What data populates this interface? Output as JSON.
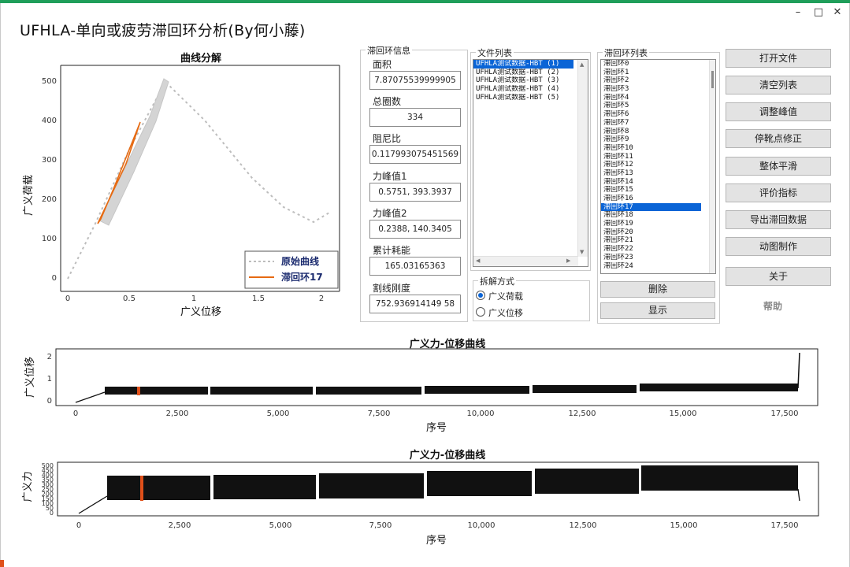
{
  "window": {
    "title": "UFHLA-单向或疲劳滞回环分析(By何小藤)",
    "minimize": "–",
    "maximize": "□",
    "close": "✕"
  },
  "decomp_chart": {
    "title": "曲线分解",
    "xlabel": "广义位移",
    "ylabel": "广义荷载",
    "xticks": [
      "0",
      "0.5",
      "1",
      "1.5",
      "2"
    ],
    "yticks": [
      "0",
      "100",
      "200",
      "300",
      "400",
      "500"
    ],
    "legend": [
      "原始曲线",
      "滞回环17"
    ]
  },
  "info": {
    "title": "滞回环信息",
    "area_label": "面积",
    "area_value": "7.87075539999905",
    "cycles_label": "总圈数",
    "cycles_value": "334",
    "damping_label": "阻尼比",
    "damping_value": "0.117993075451569",
    "peak1_label": "力峰值1",
    "peak1_value": "0.5751, 393.3937",
    "peak2_label": "力峰值2",
    "peak2_value": "0.2388, 140.3405",
    "energy_label": "累计耗能",
    "energy_value": "165.03165363",
    "stiff_label": "割线刚度",
    "stiff_value": "752.936914149 58"
  },
  "files": {
    "title": "文件列表",
    "items": [
      "UFHLA测试数据-HBT (1)",
      "UFHLA测试数据-HBT (2)",
      "UFHLA测试数据-HBT (3)",
      "UFHLA测试数据-HBT (4)",
      "UFHLA测试数据-HBT (5)"
    ]
  },
  "decomp_mode": {
    "title": "拆解方式",
    "options": [
      "广义荷载",
      "广义位移"
    ]
  },
  "loops": {
    "title": "滞回环列表",
    "items": [
      "滞回环0",
      "滞回环1",
      "滞回环2",
      "滞回环3",
      "滞回环4",
      "滞回环5",
      "滞回环6",
      "滞回环7",
      "滞回环8",
      "滞回环9",
      "滞回环10",
      "滞回环11",
      "滞回环12",
      "滞回环13",
      "滞回环14",
      "滞回环15",
      "滞回环16",
      "滞回环17",
      "滞回环18",
      "滞回环19",
      "滞回环20",
      "滞回环21",
      "滞回环22",
      "滞回环23",
      "滞回环24"
    ],
    "selected_index": 17,
    "delete_label": "删除",
    "show_label": "显示"
  },
  "buttons": [
    "打开文件",
    "清空列表",
    "调整峰值",
    "停靴点修正",
    "整体平滑",
    "评价指标",
    "导出滞回数据",
    "动图制作",
    "关于"
  ],
  "help_label": "帮助",
  "strip1": {
    "title": "广义力-位移曲线",
    "ylabel": "广义位移",
    "xlabel": "序号",
    "yticks": [
      "0",
      "1",
      "2"
    ],
    "xticks": [
      "0",
      "2,500",
      "5,000",
      "7,500",
      "10,000",
      "12,500",
      "15,000",
      "17,500"
    ]
  },
  "strip2": {
    "title": "广义力-位移曲线",
    "ylabel": "广义力",
    "xlabel": "序号",
    "yticks": [
      "0",
      "50",
      "100",
      "150",
      "200",
      "250",
      "300",
      "350",
      "400",
      "450",
      "500"
    ],
    "xticks": [
      "0",
      "2,500",
      "5,000",
      "7,500",
      "10,000",
      "12,500",
      "15,000",
      "17,500"
    ]
  },
  "colors": {
    "accent": "#1f9e5a",
    "highlight": "#e0501a",
    "selection": "#0a64d6"
  }
}
